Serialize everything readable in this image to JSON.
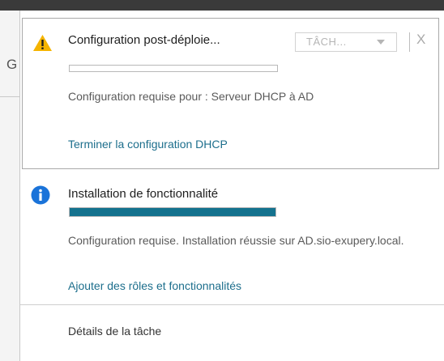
{
  "notifications": [
    {
      "title": "Configuration post-déploie...",
      "icon": "warning-icon",
      "progress": 0,
      "description": "Configuration requise pour : Serveur DHCP à AD",
      "link": "Terminer la configuration DHCP",
      "task_dropdown": "TÂCH...",
      "close": "X"
    },
    {
      "title": "Installation de fonctionnalité",
      "icon": "info-icon",
      "progress": 1.0,
      "description": "Configuration requise. Installation réussie sur AD.sio-exupery.local.",
      "link": "Ajouter des rôles et fonctionnalités"
    }
  ],
  "footer": {
    "details": "Détails de la tâche"
  },
  "background": {
    "fragment": "G"
  },
  "colors": {
    "accent": "#14728e",
    "link": "#1c6e8c",
    "warning": "#f5b400",
    "info": "#1a73d9"
  }
}
